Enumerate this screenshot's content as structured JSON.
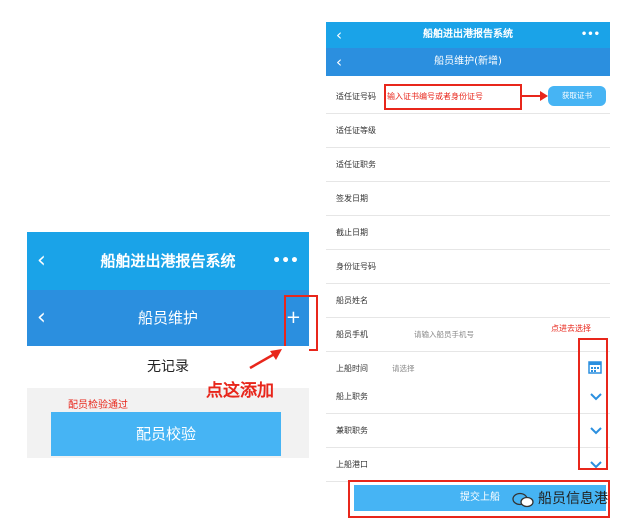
{
  "left_phone": {
    "back_glyph": "‹",
    "app_title": "船舶进出港报告系统",
    "more_glyph": "•••",
    "page_title": "船员维护",
    "add_glyph": "+",
    "empty_text": "无记录",
    "verify_status": "配员检验通过",
    "verify_button": "配员校验"
  },
  "annotations": {
    "click_add": "点这添加",
    "input_hint": "输入证书编号或者身份证号",
    "click_select": "点进去选择"
  },
  "right_phone": {
    "back_glyph": "‹",
    "app_title": "船舶进出港报告系统",
    "more_glyph": "•••",
    "page_title": "船员维护(新增)",
    "fetch_button": "获取证书",
    "submit_button": "提交上船",
    "fields": [
      {
        "label": "适任证号码",
        "value": ""
      },
      {
        "label": "适任证等级",
        "value": ""
      },
      {
        "label": "适任证职务",
        "value": ""
      },
      {
        "label": "签发日期",
        "value": ""
      },
      {
        "label": "截止日期",
        "value": ""
      },
      {
        "label": "身份证号码",
        "value": ""
      },
      {
        "label": "船员姓名",
        "value": ""
      },
      {
        "label": "船员手机",
        "placeholder": "请输入船员手机号"
      },
      {
        "label": "上船时间",
        "placeholder": "请选择"
      },
      {
        "label": "船上职务",
        "value": ""
      },
      {
        "label": "兼职职务",
        "value": ""
      },
      {
        "label": "上船港口",
        "value": ""
      }
    ]
  },
  "watermark": {
    "text": "船员信息港"
  },
  "colors": {
    "header_blue": "#1aa3e8",
    "sub_blue": "#2b8fdf",
    "button_blue": "#46b4f4",
    "annotation_red": "#e8261b"
  }
}
